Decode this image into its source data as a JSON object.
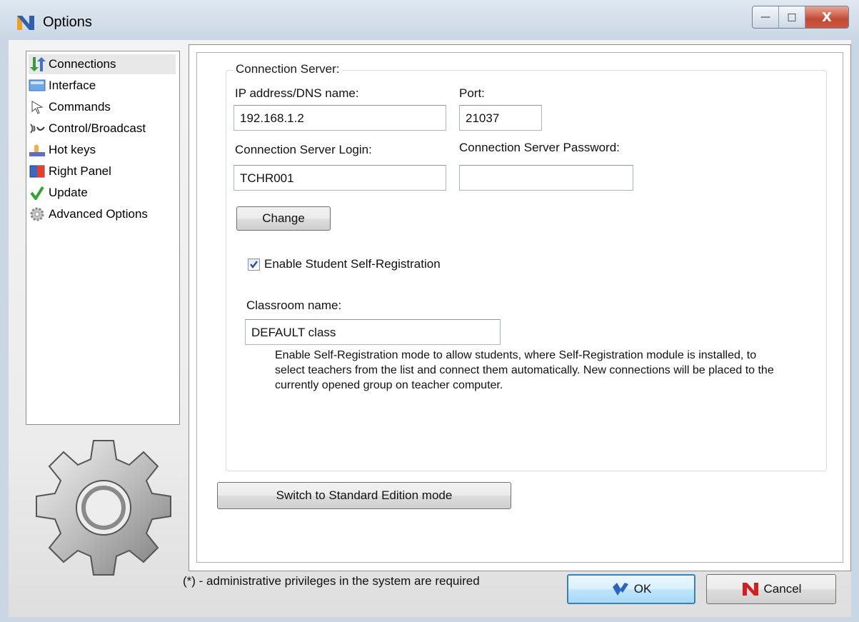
{
  "window": {
    "title": "Options"
  },
  "title_buttons": {
    "minimize": "—",
    "maximize": "□",
    "close": "X"
  },
  "sidebar": {
    "items": [
      {
        "label": "Connections",
        "icon": "connections-arrows-icon",
        "selected": true
      },
      {
        "label": "Interface",
        "icon": "monitor-icon",
        "selected": false
      },
      {
        "label": "Commands",
        "icon": "cursor-arrow-icon",
        "selected": false
      },
      {
        "label": "Control/Broadcast",
        "icon": "broadcast-icon",
        "selected": false
      },
      {
        "label": "Hot keys",
        "icon": "keyboard-hand-icon",
        "selected": false
      },
      {
        "label": "Right Panel",
        "icon": "right-panel-icon",
        "selected": false
      },
      {
        "label": "Update",
        "icon": "checkmark-icon",
        "selected": false
      },
      {
        "label": "Advanced Options",
        "icon": "gear-icon",
        "selected": false
      }
    ]
  },
  "connection_server": {
    "group_title": "Connection Server:",
    "ip_label": "IP address/DNS name:",
    "ip_value": "192.168.1.2",
    "port_label": "Port:",
    "port_value": "21037",
    "login_label": "Connection Server Login:",
    "login_value": "TCHR001",
    "password_label": "Connection Server Password:",
    "password_value": "",
    "change_button": "Change",
    "self_registration_label": "Enable Student Self-Registration",
    "self_registration_checked": true,
    "classroom_label": "Classroom name:",
    "classroom_value": "DEFAULT class",
    "help_text": "Enable Self-Registration mode to allow students, where Self-Registration module  is installed, to select teachers from the list and connect them automatically.  New connections will be placed to the currently opened group on teacher computer."
  },
  "switch_button": "Switch to Standard Edition mode",
  "footer": {
    "note": "(*) - administrative privileges in the system are required",
    "ok_label": "OK",
    "cancel_label": "Cancel"
  },
  "colors": {
    "title_bg": "#c9d6e3",
    "close_red": "#c24a35",
    "default_button_border": "#3c7fb1"
  }
}
